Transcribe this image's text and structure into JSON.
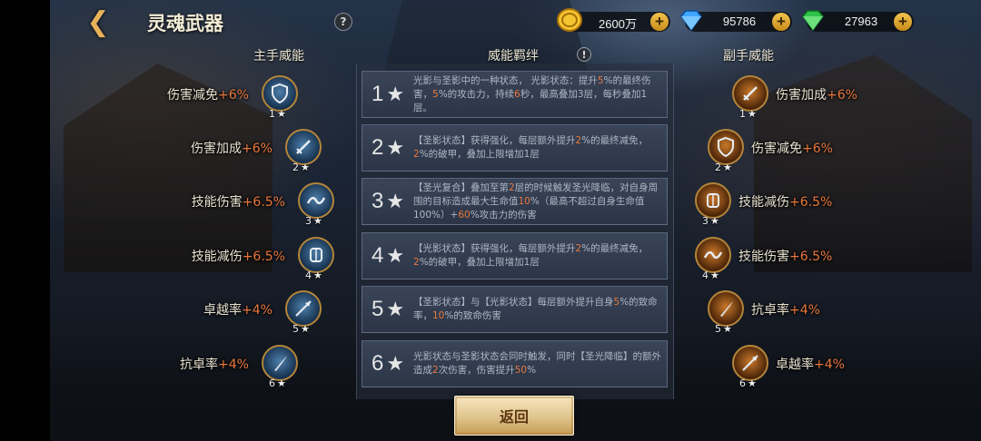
{
  "header": {
    "back_icon": "chevron-left-icon",
    "title": "灵魂武器",
    "help_label": "?"
  },
  "currencies": [
    {
      "icon": "gold-coin-icon",
      "value": "2600万",
      "plus": "+"
    },
    {
      "icon": "blue-diamond-icon",
      "value": "95786",
      "plus": "+"
    },
    {
      "icon": "green-gem-icon",
      "value": "27963",
      "plus": "+"
    }
  ],
  "columns": {
    "main_hand": "主手威能",
    "bond": "威能羁绊",
    "off_hand": "副手威能",
    "warn_label": "!"
  },
  "main_hand": [
    {
      "name": "伤害减免",
      "value": "+6%",
      "stars": "1",
      "icon": "shield-icon"
    },
    {
      "name": "伤害加成",
      "value": "+6%",
      "stars": "2",
      "icon": "sword-icon"
    },
    {
      "name": "技能伤害",
      "value": "+6.5%",
      "stars": "3",
      "icon": "wave-icon"
    },
    {
      "name": "技能减伤",
      "value": "+6.5%",
      "stars": "4",
      "icon": "armor-icon"
    },
    {
      "name": "卓越率",
      "value": "+4%",
      "stars": "5",
      "icon": "spear-icon"
    },
    {
      "name": "抗卓率",
      "value": "+4%",
      "stars": "6",
      "icon": "blade-icon"
    }
  ],
  "off_hand": [
    {
      "name": "伤害加成",
      "value": "+6%",
      "stars": "1",
      "icon": "sword-icon"
    },
    {
      "name": "伤害减免",
      "value": "+6%",
      "stars": "2",
      "icon": "shield-icon"
    },
    {
      "name": "技能减伤",
      "value": "+6.5%",
      "stars": "3",
      "icon": "armor-icon"
    },
    {
      "name": "技能伤害",
      "value": "+6.5%",
      "stars": "4",
      "icon": "wave-icon"
    },
    {
      "name": "抗卓率",
      "value": "+4%",
      "stars": "5",
      "icon": "blade-icon"
    },
    {
      "name": "卓越率",
      "value": "+4%",
      "stars": "6",
      "icon": "spear-icon"
    }
  ],
  "bonds": [
    {
      "level": "1",
      "segments": [
        {
          "t": "光影与圣影中的一种状态，\n光影状态：提升"
        },
        {
          "t": "5",
          "hl": true
        },
        {
          "t": "%的最终伤害，"
        },
        {
          "t": "5",
          "hl": true
        },
        {
          "t": "%的攻击力，持续"
        },
        {
          "t": "6",
          "hl": true
        },
        {
          "t": "秒，最高叠加3层，每秒叠加1层。"
        }
      ]
    },
    {
      "level": "2",
      "segments": [
        {
          "t": "【圣影状态】获得强化，每层额外提升"
        },
        {
          "t": "2",
          "hl": true
        },
        {
          "t": "%的最终减免，"
        },
        {
          "t": "2",
          "hl": true
        },
        {
          "t": "%的破甲，叠加上限增加1层"
        }
      ]
    },
    {
      "level": "3",
      "segments": [
        {
          "t": "【圣光复合】叠加至第"
        },
        {
          "t": "2",
          "hl": true
        },
        {
          "t": "层的时候触发圣光降临，对自身周围的目标造成最大生命值"
        },
        {
          "t": "10",
          "hl": true
        },
        {
          "t": "%（最高不超过自身生命值100%）+"
        },
        {
          "t": "60",
          "hl": true
        },
        {
          "t": "%攻击力的伤害"
        }
      ]
    },
    {
      "level": "4",
      "segments": [
        {
          "t": "【光影状态】获得强化，每层额外提升"
        },
        {
          "t": "2",
          "hl": true
        },
        {
          "t": "%的最终减免，"
        },
        {
          "t": "2",
          "hl": true
        },
        {
          "t": "%的破甲，叠加上限增加1层"
        }
      ]
    },
    {
      "level": "5",
      "segments": [
        {
          "t": "【圣影状态】与【光影状态】每层额外提升自身"
        },
        {
          "t": "5",
          "hl": true
        },
        {
          "t": "%的致命率，"
        },
        {
          "t": "10",
          "hl": true
        },
        {
          "t": "%的致命伤害"
        }
      ]
    },
    {
      "level": "6",
      "segments": [
        {
          "t": "光影状态与圣影状态会同时触发，同时【圣光降临】的额外造成"
        },
        {
          "t": "2",
          "hl": true
        },
        {
          "t": "次伤害，伤害提升"
        },
        {
          "t": "50",
          "hl": true
        },
        {
          "t": "%"
        }
      ]
    }
  ],
  "star_glyph": "★",
  "return_button": "返回",
  "colors": {
    "highlight": "#e9773c",
    "gold": "#e7b25a",
    "panel": "#3a4659"
  }
}
